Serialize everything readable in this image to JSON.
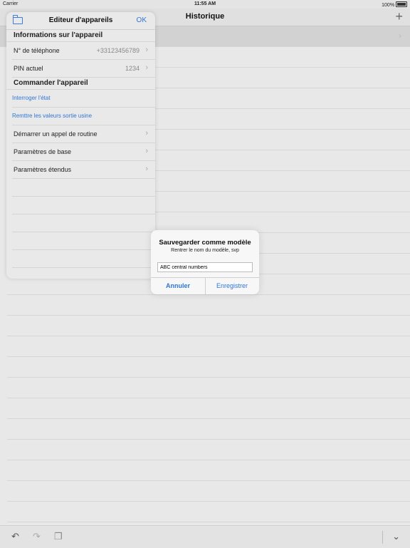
{
  "statusbar": {
    "carrier": "Carrier",
    "time": "11:55 AM",
    "battery": "100%"
  },
  "navbar": {
    "title": "Historique",
    "add_icon": "plus-icon"
  },
  "panel": {
    "title": "Editeur d'appareils",
    "ok": "OK",
    "section_info": "Informations sur l'appareil",
    "phone_label": "N° de téléphone",
    "phone_value": "+33123456789",
    "pin_label": "PIN actuel",
    "pin_value": "1234",
    "section_cmd": "Commander l'appareil",
    "query_link": "Interroger l'état",
    "reset_link": "Remttre les valeurs sortie usine",
    "routine_label": "Démarrer un appel de routine",
    "basic_label": "Paramètres de base",
    "extended_label": "Paramètres étendus"
  },
  "dialog": {
    "title": "Sauvegarder comme modèle",
    "message": "Rentrer le nom du modèle, svp",
    "input_value": "ABC central numbers",
    "cancel": "Annuler",
    "save": "Enregistrer"
  },
  "toolbar": {
    "undo_icon": "undo-icon",
    "redo_icon": "redo-icon",
    "copy_icon": "copy-icon",
    "hide_keyboard_icon": "chevron-down-icon"
  }
}
